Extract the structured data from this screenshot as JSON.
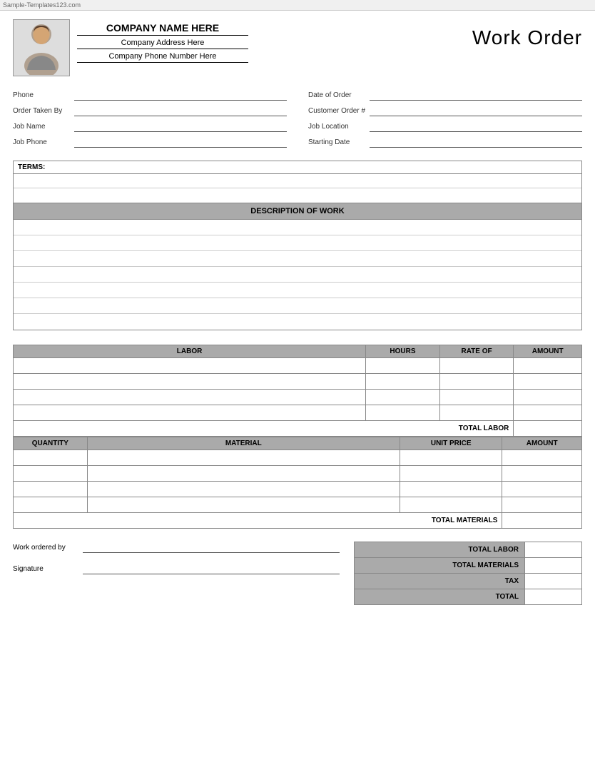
{
  "watermark": {
    "text": "Sample-Templates123.com"
  },
  "header": {
    "company_name": "COMPANY NAME HERE",
    "company_address": "Company Address Here",
    "company_phone": "Company Phone Number Here",
    "title": "Work Order"
  },
  "form": {
    "left": [
      {
        "label": "Phone",
        "id": "phone"
      },
      {
        "label": "Order Taken By",
        "id": "order-taken-by"
      },
      {
        "label": "Job Name",
        "id": "job-name"
      },
      {
        "label": "Job Phone",
        "id": "job-phone"
      }
    ],
    "right": [
      {
        "label": "Date of Order",
        "id": "date-of-order"
      },
      {
        "label": "Customer Order #",
        "id": "customer-order"
      },
      {
        "label": "Job Location",
        "id": "job-location"
      },
      {
        "label": "Starting Date",
        "id": "starting-date"
      }
    ]
  },
  "terms": {
    "label": "TERMS:"
  },
  "description_of_work": {
    "header": "DESCRIPTION OF WORK",
    "rows": 7
  },
  "labor": {
    "columns": [
      "LABOR",
      "HOURS",
      "RATE OF",
      "AMOUNT"
    ],
    "rows": 4,
    "total_label": "TOTAL LABOR"
  },
  "materials": {
    "columns": [
      "QUANTITY",
      "MATERIAL",
      "UNIT PRICE",
      "AMOUNT"
    ],
    "rows": 4,
    "total_label": "TOTAL MATERIALS"
  },
  "summary": {
    "rows": [
      {
        "label": "TOTAL LABOR"
      },
      {
        "label": "TOTAL MATERIALS"
      },
      {
        "label": "TAX"
      },
      {
        "label": "TOTAL"
      }
    ],
    "work_ordered_by_label": "Work ordered by",
    "signature_label": "Signature"
  }
}
